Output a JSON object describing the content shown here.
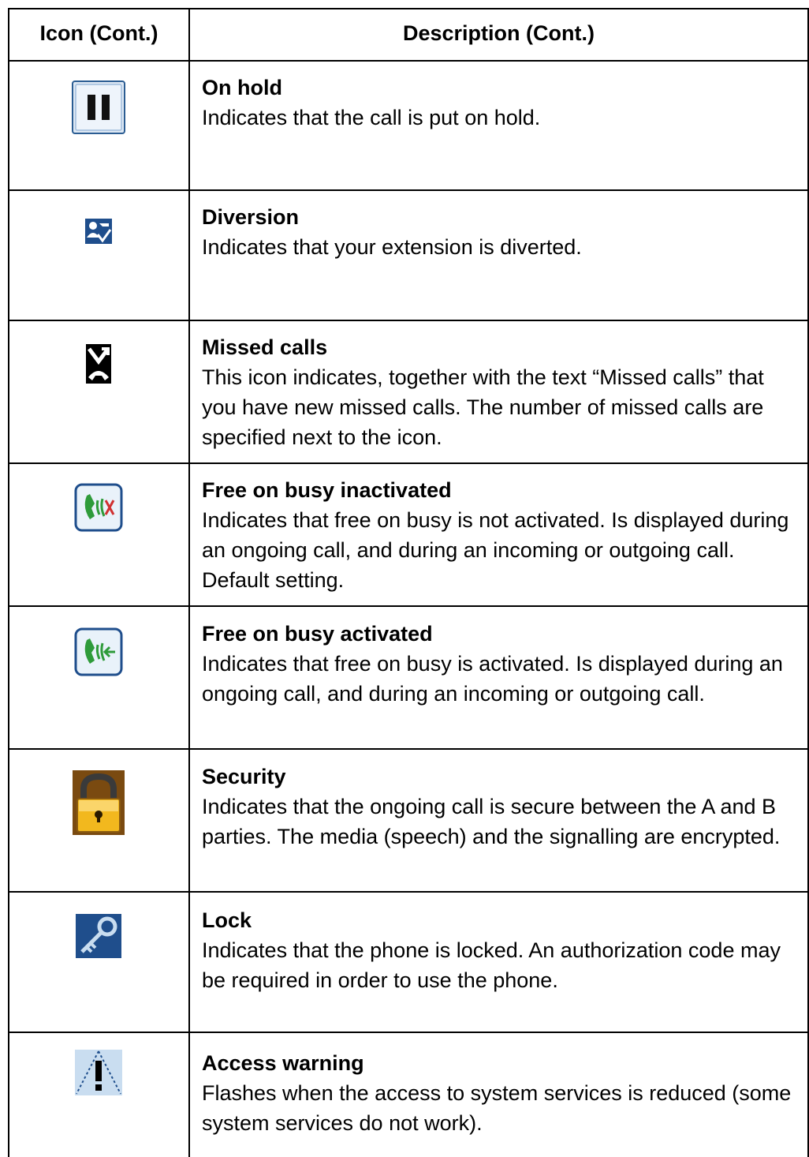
{
  "header": {
    "icon_col": "Icon  (Cont.)",
    "desc_col": "Description  (Cont.)"
  },
  "rows": [
    {
      "icon": "pause-icon",
      "title": "On hold",
      "text": "Indicates that the call is put on hold."
    },
    {
      "icon": "diversion-icon",
      "title": "Diversion",
      "text": "Indicates that your extension is diverted."
    },
    {
      "icon": "missed-calls-icon",
      "title": "Missed calls",
      "text": "This icon indicates, together with the text “Missed calls” that you have new missed calls. The number of missed calls are specified next to the icon."
    },
    {
      "icon": "free-on-busy-inactivated-icon",
      "title": "Free on busy inactivated",
      "text": "Indicates that free on busy is not activated. Is displayed during an ongoing call, and during an incoming or outgoing call. Default setting."
    },
    {
      "icon": "free-on-busy-activated-icon",
      "title": "Free on busy activated",
      "text": "Indicates that free on busy is activated. Is displayed during an ongoing call, and during an incoming or outgoing call."
    },
    {
      "icon": "padlock-icon",
      "title": "Security",
      "text": "Indicates that the ongoing call is secure between the A and B parties. The media (speech) and the signalling are encrypted."
    },
    {
      "icon": "key-icon",
      "title": "Lock",
      "text": "Indicates that the phone is locked. An authorization code may be required in order to use the phone."
    },
    {
      "icon": "access-warning-icon",
      "title": "Access warning",
      "text": "Flashes when the access to system services is reduced (some system services do not work)."
    }
  ],
  "colors": {
    "icon_blue": "#1f4e8c",
    "icon_light_blue": "#c9ddf0",
    "lock_gold": "#f2b81e"
  }
}
